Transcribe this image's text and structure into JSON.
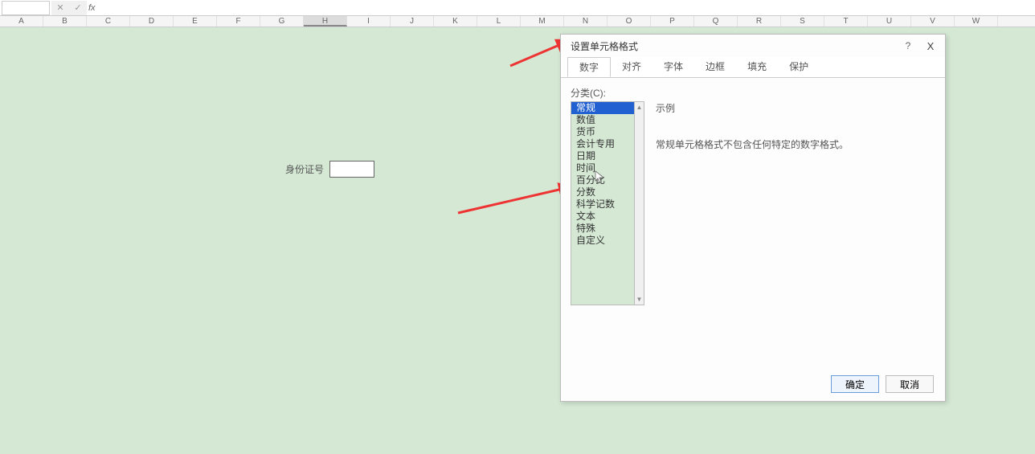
{
  "formula_bar": {
    "fx": "fx"
  },
  "columns": [
    "A",
    "B",
    "C",
    "D",
    "E",
    "F",
    "G",
    "H",
    "I",
    "J",
    "K",
    "L",
    "M",
    "N",
    "O",
    "P",
    "Q",
    "R",
    "S",
    "T",
    "U",
    "V",
    "W"
  ],
  "active_col": "H",
  "cell_label": "身份证号",
  "dialog": {
    "title": "设置单元格格式",
    "help": "?",
    "close": "X",
    "tabs": [
      "数字",
      "对齐",
      "字体",
      "边框",
      "填充",
      "保护"
    ],
    "active_tab": "数字",
    "category_label": "分类(C):",
    "categories": [
      "常规",
      "数值",
      "货币",
      "会计专用",
      "日期",
      "时间",
      "百分比",
      "分数",
      "科学记数",
      "文本",
      "特殊",
      "自定义"
    ],
    "selected_category": "常规",
    "sample_label": "示例",
    "description": "常规单元格格式不包含任何特定的数字格式。",
    "ok": "确定",
    "cancel": "取消"
  }
}
